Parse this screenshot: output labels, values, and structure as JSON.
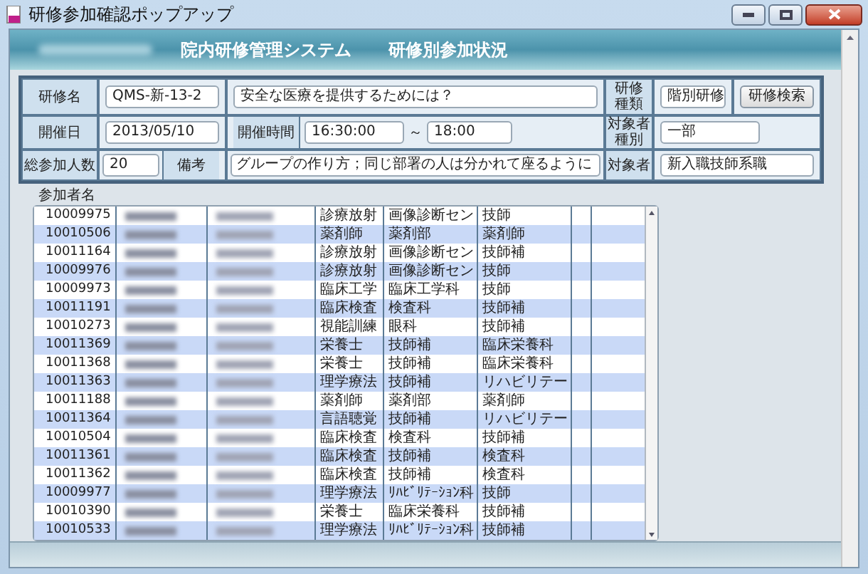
{
  "window": {
    "title": "研修参加確認ポップアップ"
  },
  "header": {
    "system": "院内研修管理システム",
    "screen": "研修別参加状況"
  },
  "form": {
    "course_name_label": "研修名",
    "course_code": "QMS-新-13-2",
    "course_title": "安全な医療を提供するためには？",
    "course_type_label": "研修種類",
    "course_type": "階別研修",
    "search_button": "研修検索",
    "date_label": "開催日",
    "date": "2013/05/10",
    "time_label": "開催時間",
    "time_from": "16:30:00",
    "time_sep": "～",
    "time_to": "18:00",
    "target_type_label": "対象者種別",
    "target_type": "一部",
    "count_label": "総参加人数",
    "count": "20",
    "note_label": "備考",
    "note": "グループの作り方；同じ部署の人は分かれて座るように",
    "target_label": "対象者",
    "target": "新入職技師系職"
  },
  "participants_label": "参加者名",
  "table": {
    "rows": [
      {
        "column_1": "10009975",
        "column_4": "診療放射",
        "column_5": "画像診断セン",
        "column_6": "技師"
      },
      {
        "column_1": "10010506",
        "column_4": "薬剤師",
        "column_5": "薬剤部",
        "column_6": "薬剤師"
      },
      {
        "column_1": "10011164",
        "column_4": "診療放射",
        "column_5": "画像診断セン",
        "column_6": "技師補"
      },
      {
        "column_1": "10009976",
        "column_4": "診療放射",
        "column_5": "画像診断セン",
        "column_6": "技師"
      },
      {
        "column_1": "10009973",
        "column_4": "臨床工学",
        "column_5": "臨床工学科",
        "column_6": "技師"
      },
      {
        "column_1": "10011191",
        "column_4": "臨床検査",
        "column_5": "検査科",
        "column_6": "技師補"
      },
      {
        "column_1": "10010273",
        "column_4": "視能訓練",
        "column_5": "眼科",
        "column_6": "技師補"
      },
      {
        "column_1": "10011369",
        "column_4": "栄養士",
        "column_5": "技師補",
        "column_6": "臨床栄養科"
      },
      {
        "column_1": "10011368",
        "column_4": "栄養士",
        "column_5": "技師補",
        "column_6": "臨床栄養科"
      },
      {
        "column_1": "10011363",
        "column_4": "理学療法",
        "column_5": "技師補",
        "column_6": "リハビリテー"
      },
      {
        "column_1": "10011188",
        "column_4": "薬剤師",
        "column_5": "薬剤部",
        "column_6": "薬剤師"
      },
      {
        "column_1": "10011364",
        "column_4": "言語聴覚",
        "column_5": "技師補",
        "column_6": "リハビリテー"
      },
      {
        "column_1": "10010504",
        "column_4": "臨床検査",
        "column_5": "検査科",
        "column_6": "技師補"
      },
      {
        "column_1": "10011361",
        "column_4": "臨床検査",
        "column_5": "技師補",
        "column_6": "検査科"
      },
      {
        "column_1": "10011362",
        "column_4": "臨床検査",
        "column_5": "技師補",
        "column_6": "検査科"
      },
      {
        "column_1": "10009977",
        "column_4": "理学療法",
        "column_5": "ﾘﾊﾋﾞﾘﾃｰｼｮﾝ科",
        "column_6": "技師"
      },
      {
        "column_1": "10010390",
        "column_4": "栄養士",
        "column_5": "臨床栄養科",
        "column_6": "技師補"
      },
      {
        "column_1": "10010533",
        "column_4": "理学療法",
        "column_5": "ﾘﾊﾋﾞﾘﾃｰｼｮﾝ科",
        "column_6": "技師補"
      }
    ]
  }
}
